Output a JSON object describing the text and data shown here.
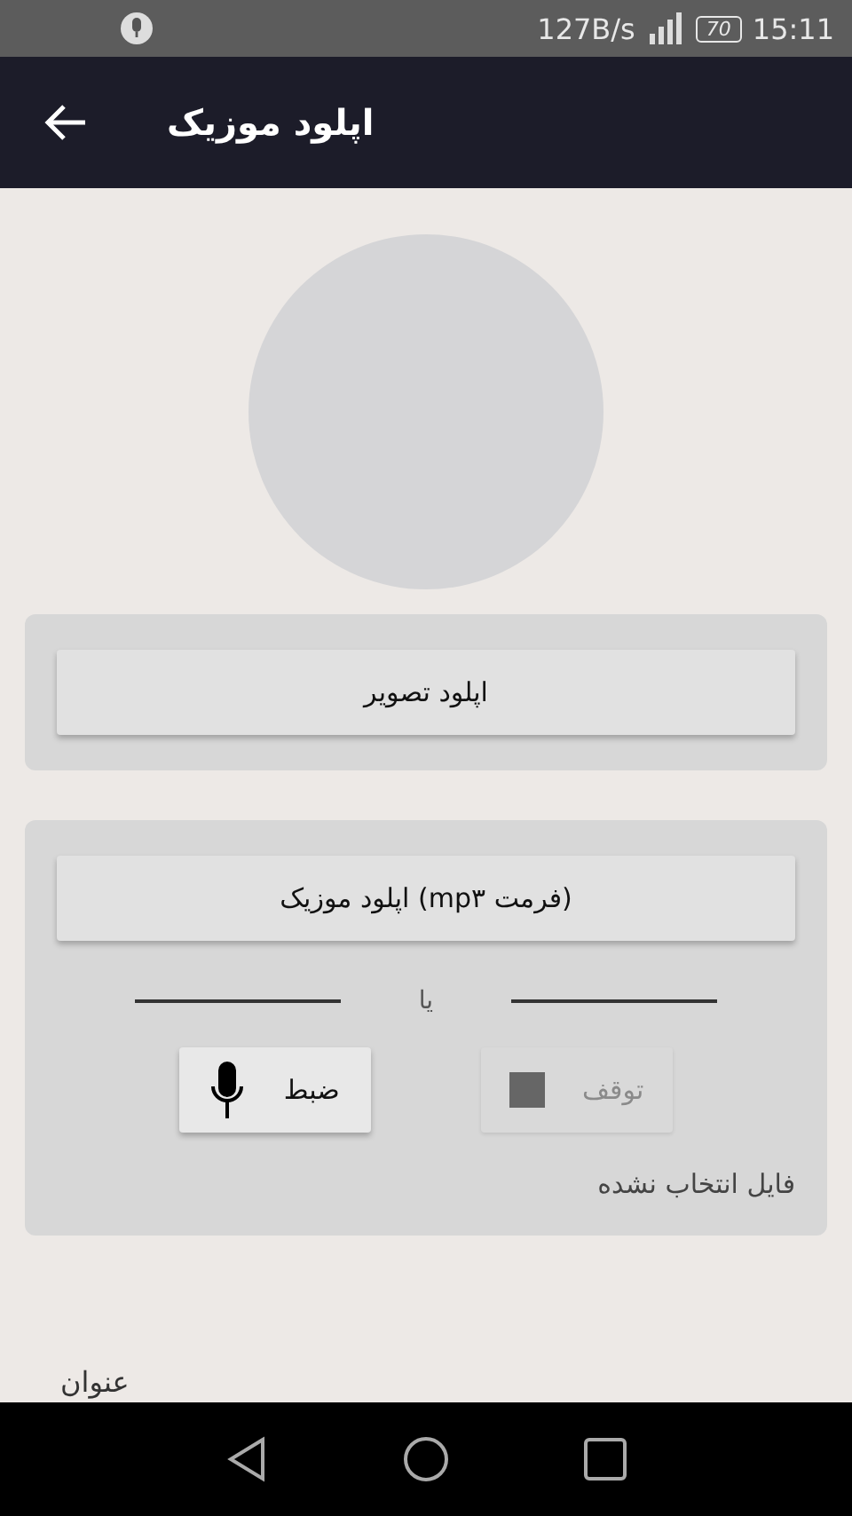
{
  "status_bar": {
    "speed": "127B/s",
    "battery": "70",
    "time": "15:11"
  },
  "app_bar": {
    "title": "اپلود موزیک"
  },
  "image_card": {
    "button": "اپلود تصویر"
  },
  "music_card": {
    "upload_button": "اپلود موزیک (mp۳ فرمت)",
    "divider_text": "یا",
    "controls": [
      {
        "kind": "stop",
        "label": "توقف",
        "disabled": true
      },
      {
        "kind": "record",
        "label": "ضبط",
        "disabled": false
      }
    ],
    "file_status": "فایل انتخاب نشده"
  },
  "title_label": "عنوان"
}
